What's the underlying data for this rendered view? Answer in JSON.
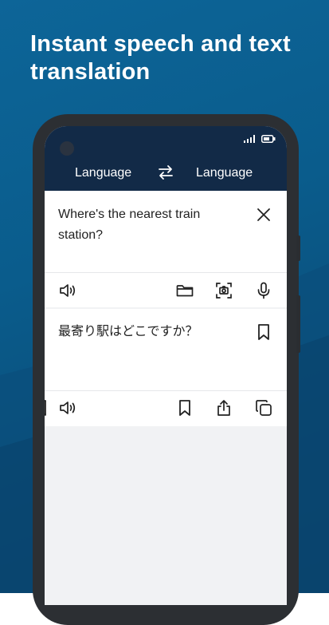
{
  "headline": "Instant speech and text translation",
  "header": {
    "source_language": "Language",
    "target_language": "Language"
  },
  "source_panel": {
    "text": "Where's the nearest train station?"
  },
  "target_panel": {
    "text": "最寄り駅はどこですか？"
  },
  "colors": {
    "background": "#0b5a8a",
    "app_bar": "#122a47",
    "phone_frame": "#2c2f33",
    "icon": "#222222"
  },
  "icons": [
    "signal-icon",
    "battery-icon",
    "swap-icon",
    "close-icon",
    "speaker-icon",
    "folder-icon",
    "camera-scan-icon",
    "microphone-icon",
    "bookmark-icon",
    "share-icon",
    "copy-icon"
  ]
}
